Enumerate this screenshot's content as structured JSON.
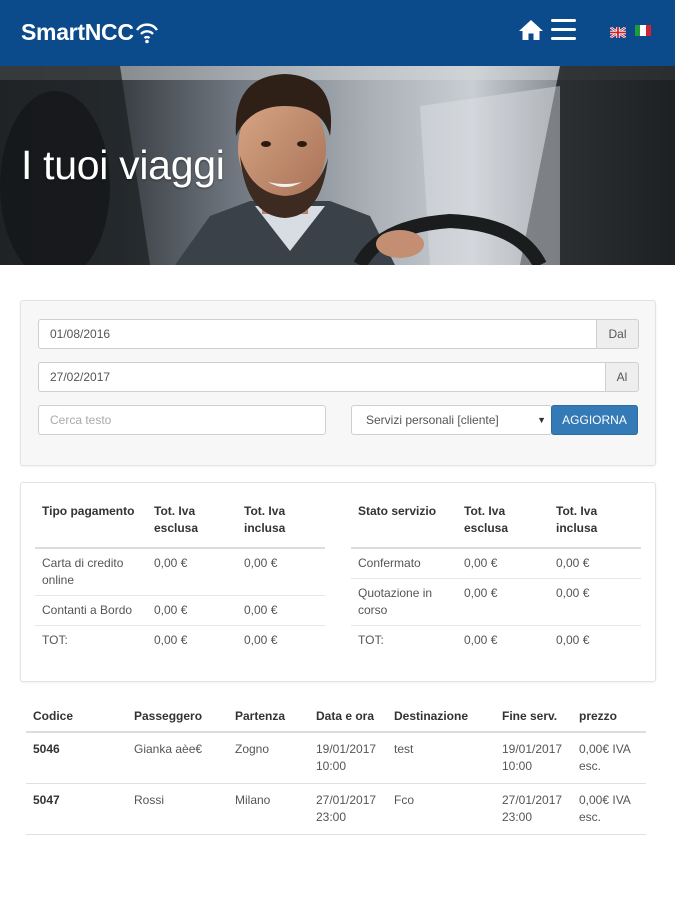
{
  "header": {
    "logo_text": "SmartNCC",
    "brand_color": "#0b4a8b",
    "icons": [
      "home-icon",
      "hamburger-menu-icon",
      "flag-uk-icon",
      "flag-it-icon"
    ]
  },
  "hero": {
    "title": "I tuoi viaggi"
  },
  "filters": {
    "from_date": "01/08/2016",
    "from_label": "Dal",
    "to_date": "27/02/2017",
    "to_label": "Al",
    "search_placeholder": "Cerca testo",
    "service_select": "Servizi personali [cliente]",
    "update_button": "AGGIORNA",
    "accent_color": "#337ab7"
  },
  "payment_summary": {
    "headers": [
      "Tipo pagamento",
      "Tot. Iva esclusa",
      "Tot. Iva inclusa"
    ],
    "rows": [
      [
        "Carta di credito online",
        "0,00 €",
        "0,00 €"
      ],
      [
        "Contanti a Bordo",
        "0,00 €",
        "0,00 €"
      ],
      [
        "TOT:",
        "0,00 €",
        "0,00 €"
      ]
    ]
  },
  "status_summary": {
    "headers": [
      "Stato servizio",
      "Tot. Iva esclusa",
      "Tot. Iva inclusa"
    ],
    "rows": [
      [
        "Confermato",
        "0,00 €",
        "0,00 €"
      ],
      [
        "Quotazione in corso",
        "0,00 €",
        "0,00 €"
      ],
      [
        "TOT:",
        "0,00 €",
        "0,00 €"
      ]
    ]
  },
  "trips": {
    "headers": [
      "Codice",
      "Passeggero",
      "Partenza",
      "Data e ora",
      "Destinazione",
      "Fine serv.",
      "prezzo"
    ],
    "rows": [
      [
        "5046",
        "Gianka aèe€",
        "Zogno",
        "19/01/2017 10:00",
        "test",
        "19/01/2017 10:00",
        "0,00€ IVA esc."
      ],
      [
        "5047",
        "Rossi",
        "Milano",
        "27/01/2017 23:00",
        "Fco",
        "27/01/2017 23:00",
        "0,00€ IVA esc."
      ]
    ]
  }
}
